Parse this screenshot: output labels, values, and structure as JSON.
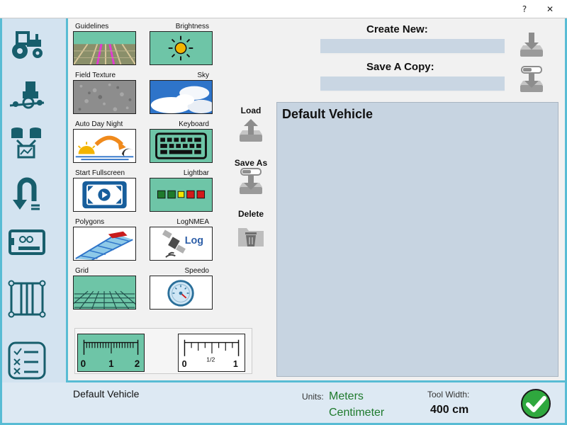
{
  "titlebar": {
    "help_label": "?",
    "close_label": "✕"
  },
  "sidebar": {
    "items": [
      {
        "name": "tractor-icon"
      },
      {
        "name": "implement-icon"
      },
      {
        "name": "data-sources-icon"
      },
      {
        "name": "uturn-icon"
      },
      {
        "name": "arduino-board-icon"
      },
      {
        "name": "tram-lines-icon"
      },
      {
        "name": "checklist-icon"
      }
    ]
  },
  "features": {
    "guidelines": "Guidelines",
    "brightness": "Brightness",
    "field_texture": "Field Texture",
    "sky": "Sky",
    "auto_day_night": "Auto Day Night",
    "keyboard": "Keyboard",
    "start_fullscreen": "Start Fullscreen",
    "lightbar": "Lightbar",
    "polygons": "Polygons",
    "lognmea": "LogNMEA",
    "grid": "Grid",
    "speedo": "Speedo"
  },
  "icon_text": {
    "log": "Log"
  },
  "metric_ruler": {
    "ticks": [
      "0",
      "1",
      "2"
    ]
  },
  "imperial_ruler": {
    "ticks": [
      "0",
      "1/2",
      "1"
    ]
  },
  "vehicle_actions": {
    "load": "Load",
    "save_as": "Save As",
    "delete": "Delete"
  },
  "create_new": {
    "label": "Create New:",
    "value": ""
  },
  "save_copy": {
    "label": "Save A Copy:",
    "value": ""
  },
  "vehicle_list": {
    "items": [
      "Default Vehicle"
    ]
  },
  "footer": {
    "current_vehicle": "Default Vehicle",
    "units_label": "Units:",
    "units_primary": "Meters",
    "units_secondary": "Centimeter",
    "tool_width_label": "Tool Width:",
    "tool_width_value": "400 cm"
  },
  "colors": {
    "accent": "#58bcd4",
    "teal": "#175e6c",
    "tile_green": "#6ec5a7",
    "ok_green": "#2fa83e"
  }
}
